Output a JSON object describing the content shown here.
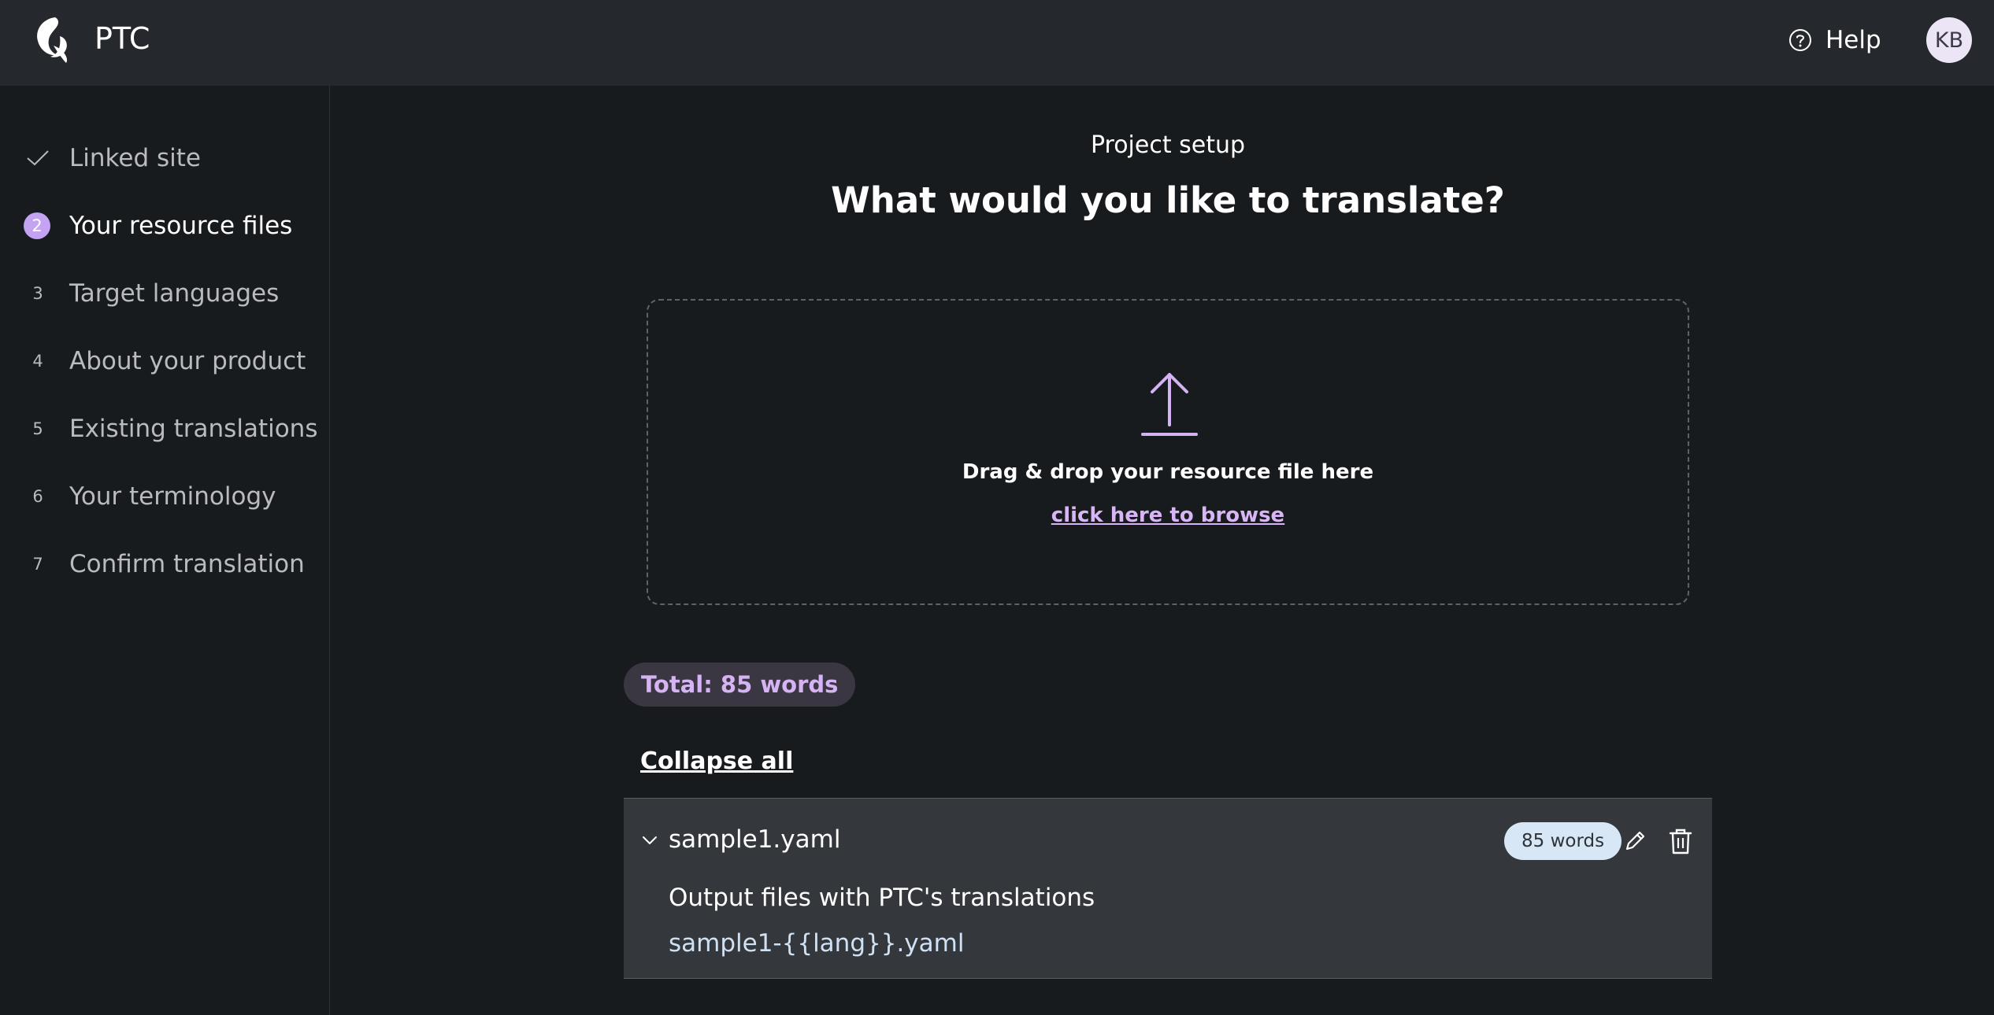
{
  "header": {
    "brand": "PTC",
    "help_label": "Help",
    "avatar_initials": "KB"
  },
  "sidebar": {
    "steps": [
      {
        "marker": "",
        "label": "Linked site",
        "state": "completed"
      },
      {
        "marker": "2",
        "label": "Your resource files",
        "state": "active"
      },
      {
        "marker": "3",
        "label": "Target languages",
        "state": "pending"
      },
      {
        "marker": "4",
        "label": "About your product",
        "state": "pending"
      },
      {
        "marker": "5",
        "label": "Existing translations",
        "state": "pending"
      },
      {
        "marker": "6",
        "label": "Your terminology",
        "state": "pending"
      },
      {
        "marker": "7",
        "label": "Confirm translation",
        "state": "pending"
      }
    ]
  },
  "main": {
    "eyebrow": "Project setup",
    "title": "What would you like to translate?",
    "dropzone": {
      "text": "Drag & drop your resource file here",
      "link": "click here to browse"
    },
    "total_badge": "Total: 85 words",
    "collapse_all": "Collapse all",
    "files": [
      {
        "name": "sample1.yaml",
        "words": "85 words",
        "output_label": "Output files with PTC's translations",
        "output_pattern": "sample1-{{lang}}.yaml"
      }
    ]
  },
  "colors": {
    "background": "#181b1d",
    "topbar": "#25282c",
    "accent": "#c5a3f3",
    "link": "#d8b6f6",
    "card": "#34383c",
    "badge": "#d8e7f6"
  }
}
